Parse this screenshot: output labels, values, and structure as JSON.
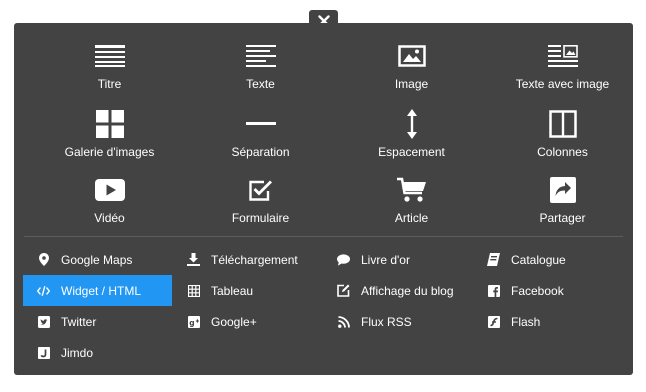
{
  "close": {
    "symbol": "✕"
  },
  "content_blocks": [
    {
      "label": "Titre",
      "icon": "heading-icon"
    },
    {
      "label": "Texte",
      "icon": "text-icon"
    },
    {
      "label": "Image",
      "icon": "image-icon"
    },
    {
      "label": "Texte avec image",
      "icon": "text-with-image-icon"
    },
    {
      "label": "Galerie d'images",
      "icon": "gallery-icon"
    },
    {
      "label": "Séparation",
      "icon": "separator-icon"
    },
    {
      "label": "Espacement",
      "icon": "spacing-icon"
    },
    {
      "label": "Colonnes",
      "icon": "columns-icon"
    },
    {
      "label": "Vidéo",
      "icon": "video-icon"
    },
    {
      "label": "Formulaire",
      "icon": "form-icon"
    },
    {
      "label": "Article",
      "icon": "cart-icon"
    },
    {
      "label": "Partager",
      "icon": "share-icon"
    }
  ],
  "widgets": [
    {
      "label": "Google Maps",
      "icon": "map-pin-icon",
      "active": false
    },
    {
      "label": "Téléchargement",
      "icon": "download-icon",
      "active": false
    },
    {
      "label": "Livre d'or",
      "icon": "speech-bubble-icon",
      "active": false
    },
    {
      "label": "Catalogue",
      "icon": "catalogue-icon",
      "active": false
    },
    {
      "label": "Widget / HTML",
      "icon": "code-icon",
      "active": true
    },
    {
      "label": "Tableau",
      "icon": "table-icon",
      "active": false
    },
    {
      "label": "Affichage du blog",
      "icon": "edit-icon",
      "active": false
    },
    {
      "label": "Facebook",
      "icon": "facebook-icon",
      "active": false
    },
    {
      "label": "Twitter",
      "icon": "twitter-icon",
      "active": false
    },
    {
      "label": "Google+",
      "icon": "google-plus-icon",
      "active": false
    },
    {
      "label": "Flux RSS",
      "icon": "rss-icon",
      "active": false
    },
    {
      "label": "Flash",
      "icon": "flash-icon",
      "active": false
    },
    {
      "label": "Jimdo",
      "icon": "jimdo-icon",
      "active": false
    }
  ],
  "colors": {
    "panel": "#434343",
    "accent": "#2196f3",
    "text": "#ffffff"
  }
}
